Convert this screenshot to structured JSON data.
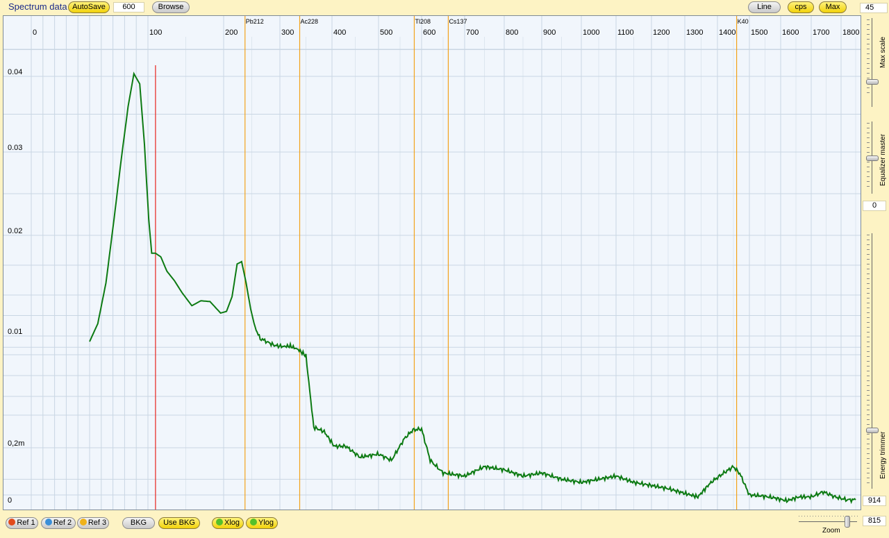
{
  "header": {
    "title": "Spectrum data",
    "autosave_label": "AutoSave",
    "interval_value": "600",
    "browse_label": "Browse",
    "line_label": "Line",
    "cps_label": "cps",
    "max_label": "Max",
    "corner_value": "45"
  },
  "right_panel": {
    "max_scale_label": "Max scale",
    "equalizer_label": "Equalizer master",
    "equalizer_value": "0",
    "energy_trimmer_label": "Energy trimmer",
    "energy_trimmer_value": "914",
    "zoom_label": "Zoom",
    "zoom_value": "815"
  },
  "footer": {
    "ref1_label": "Ref 1",
    "ref2_label": "Ref 2",
    "ref3_label": "Ref 3",
    "bkg_label": "BKG",
    "use_bkg_label": "Use BKG",
    "xlog_label": "Xlog",
    "ylog_label": "Ylog"
  },
  "colors": {
    "spectrum_line": "#0c7a12",
    "isotope_marker": "#f2a21a",
    "cursor_line": "#e8231b",
    "grid": "#c9d6e3",
    "plot_background": "#f1f6fc"
  },
  "chart_data": {
    "type": "line",
    "x_scale": "log",
    "y_scale": "log",
    "x_ticks": [
      0,
      100,
      200,
      300,
      400,
      500,
      600,
      700,
      800,
      900,
      1000,
      1100,
      1200,
      1300,
      1400,
      1500,
      1600,
      1700,
      1800
    ],
    "y_ticks": [
      {
        "label": "0",
        "value": 0
      },
      {
        "label": "0,2m",
        "value": 0.0002
      },
      {
        "label": "0.01",
        "value": 0.01
      },
      {
        "label": "0.02",
        "value": 0.02
      },
      {
        "label": "0.03",
        "value": 0.03
      },
      {
        "label": "0.04",
        "value": 0.04
      }
    ],
    "cursor_x": 110,
    "isotopes": [
      {
        "name": "Pb212",
        "energy": 238
      },
      {
        "name": "Ac228",
        "energy": 338
      },
      {
        "name": "Tl208",
        "energy": 583
      },
      {
        "name": "Cs137",
        "energy": 662
      },
      {
        "name": "K40",
        "energy": 1460
      }
    ],
    "series": [
      {
        "x": [
          50,
          57,
          64,
          71,
          77,
          83,
          88,
          93,
          97,
          101,
          105,
          110,
          117,
          125,
          135,
          145,
          158,
          170,
          182,
          196,
          205,
          215,
          224,
          232,
          240,
          248,
          256,
          265,
          275,
          290,
          305,
          320,
          335,
          350,
          365,
          385,
          405,
          430,
          460,
          500,
          530,
          560,
          580,
          600,
          620,
          650,
          700,
          750,
          800,
          850,
          900,
          950,
          1000,
          1050,
          1100,
          1150,
          1200,
          1250,
          1300,
          1340,
          1380,
          1420,
          1450,
          1470,
          1500,
          1540,
          1580,
          1620,
          1660,
          1700,
          1740,
          1780,
          1820,
          1850
        ],
        "y": [
          0.0085,
          0.0115,
          0.016,
          0.022,
          0.029,
          0.036,
          0.0405,
          0.039,
          0.031,
          0.022,
          0.0185,
          0.0185,
          0.0182,
          0.017,
          0.0162,
          0.0152,
          0.0137,
          0.0143,
          0.0142,
          0.0128,
          0.013,
          0.0148,
          0.0176,
          0.0178,
          0.016,
          0.0133,
          0.011,
          0.0093,
          0.0086,
          0.0075,
          0.0072,
          0.0073,
          0.0064,
          0.0049,
          0.00036,
          0.00031,
          0.00021,
          0.00021,
          0.00017,
          0.00018,
          0.00016,
          0.00026,
          0.00033,
          0.00034,
          0.00016,
          0.00012,
          0.00011,
          0.00014,
          0.00013,
          0.00011,
          0.00012,
          0.0001,
          9e-05,
          0.0001,
          0.00011,
          9e-05,
          8e-05,
          7e-05,
          5.5e-05,
          4e-05,
          9e-05,
          0.00012,
          0.00014,
          0.000118,
          5e-05,
          4.5e-05,
          3.5e-05,
          2e-05,
          4e-05,
          4e-05,
          6e-05,
          4e-05,
          2.5e-05,
          2.5e-05
        ]
      }
    ]
  }
}
